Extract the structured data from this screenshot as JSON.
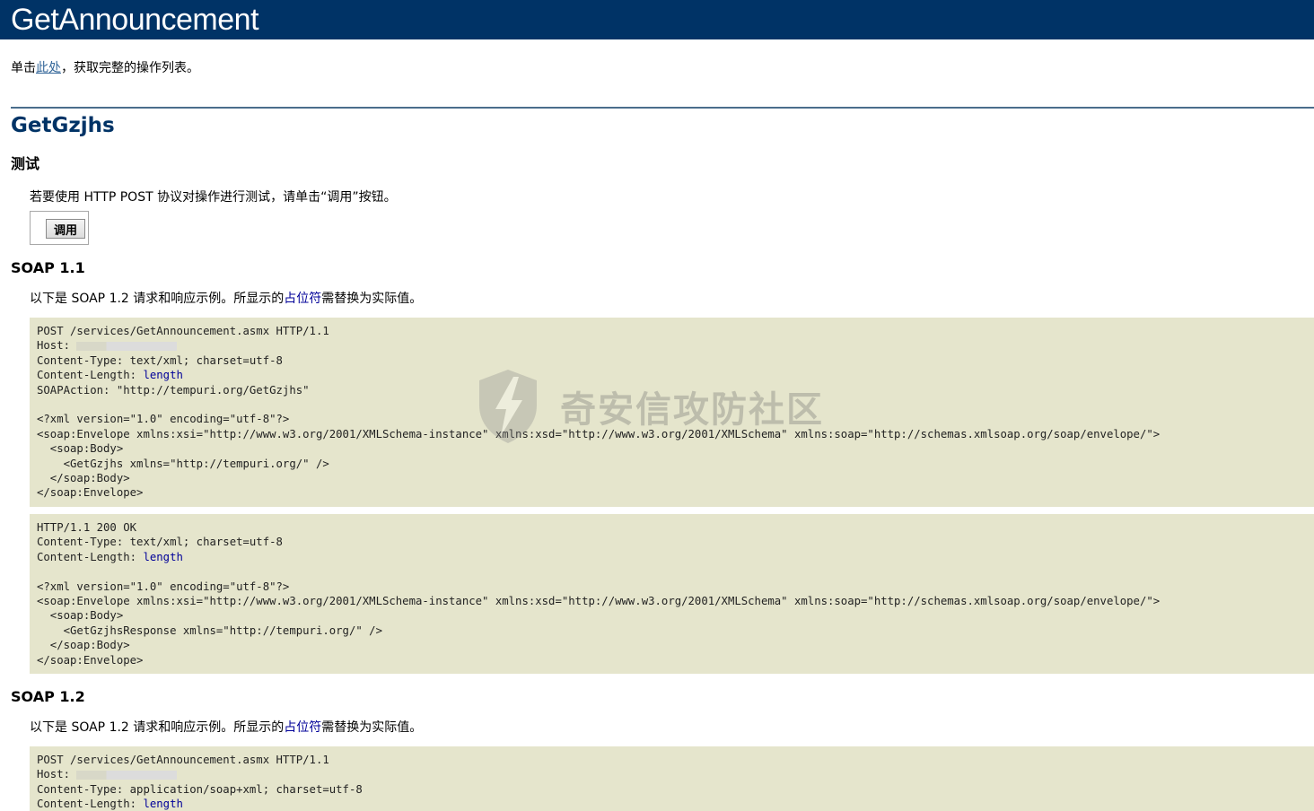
{
  "header": {
    "title": "GetAnnouncement"
  },
  "intro": {
    "prefix": "单击",
    "link": "此处",
    "suffix": "，获取完整的操作列表。"
  },
  "operation": {
    "name": "GetGzjhs"
  },
  "test": {
    "heading": "测试",
    "description": "若要使用 HTTP POST 协议对操作进行测试，请单击“调用”按钮。",
    "invoke_label": "调用"
  },
  "soap11": {
    "heading": "SOAP 1.1",
    "desc_prefix": "以下是 SOAP 1.2 请求和响应示例。所显示的",
    "desc_link": "占位符",
    "desc_suffix": "需替换为实际值。",
    "request": {
      "l1": "POST /services/GetAnnouncement.asmx HTTP/1.1",
      "host_label": "Host: ",
      "l3": "Content-Type: text/xml; charset=utf-8",
      "len_label": "Content-Length: ",
      "len_ph": "length",
      "l5": "SOAPAction: \"http://tempuri.org/GetGzjhs\"",
      "body": "<?xml version=\"1.0\" encoding=\"utf-8\"?>\n<soap:Envelope xmlns:xsi=\"http://www.w3.org/2001/XMLSchema-instance\" xmlns:xsd=\"http://www.w3.org/2001/XMLSchema\" xmlns:soap=\"http://schemas.xmlsoap.org/soap/envelope/\">\n  <soap:Body>\n    <GetGzjhs xmlns=\"http://tempuri.org/\" />\n  </soap:Body>\n</soap:Envelope>"
    },
    "response": {
      "l1": "HTTP/1.1 200 OK",
      "l2": "Content-Type: text/xml; charset=utf-8",
      "len_label": "Content-Length: ",
      "len_ph": "length",
      "body": "<?xml version=\"1.0\" encoding=\"utf-8\"?>\n<soap:Envelope xmlns:xsi=\"http://www.w3.org/2001/XMLSchema-instance\" xmlns:xsd=\"http://www.w3.org/2001/XMLSchema\" xmlns:soap=\"http://schemas.xmlsoap.org/soap/envelope/\">\n  <soap:Body>\n    <GetGzjhsResponse xmlns=\"http://tempuri.org/\" />\n  </soap:Body>\n</soap:Envelope>"
    }
  },
  "soap12": {
    "heading": "SOAP 1.2",
    "desc_prefix": "以下是 SOAP 1.2 请求和响应示例。所显示的",
    "desc_link": "占位符",
    "desc_suffix": "需替换为实际值。",
    "request": {
      "l1": "POST /services/GetAnnouncement.asmx HTTP/1.1",
      "host_label": "Host: ",
      "l3": "Content-Type: application/soap+xml; charset=utf-8",
      "len_label": "Content-Length: ",
      "len_ph": "length"
    }
  },
  "watermark": {
    "text": "奇安信攻防社区"
  },
  "colors": {
    "header_bg": "#003366",
    "code_bg": "#e5e5cc",
    "placeholder": "#000099",
    "link": "#336699"
  }
}
